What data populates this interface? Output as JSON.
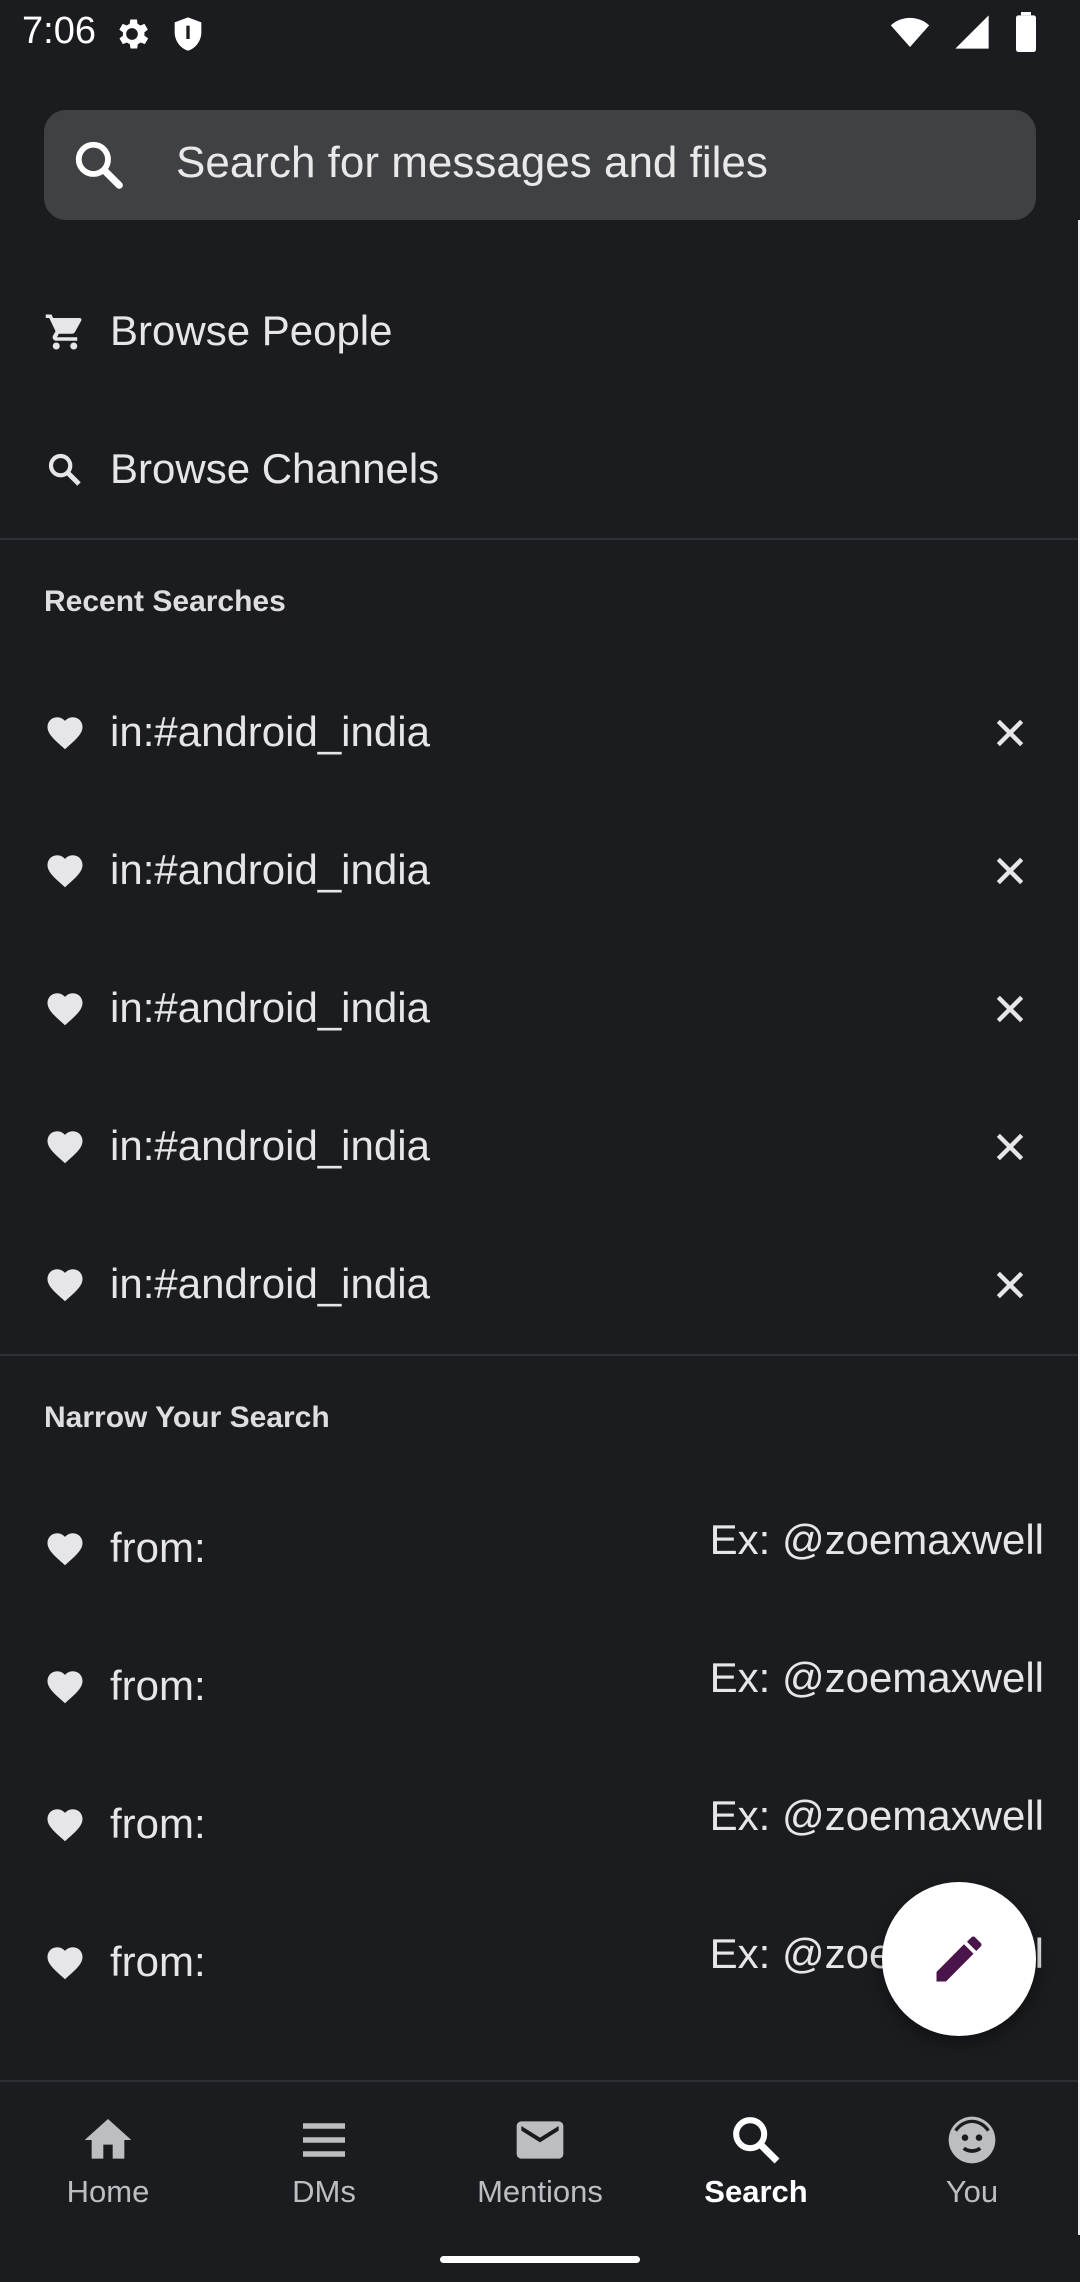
{
  "status": {
    "time": "7:06"
  },
  "search": {
    "placeholder": "Search for messages and files"
  },
  "browse": {
    "people_label": "Browse People",
    "channels_label": "Browse Channels"
  },
  "recent": {
    "title": "Recent Searches",
    "items": [
      {
        "label": "in:#android_india"
      },
      {
        "label": "in:#android_india"
      },
      {
        "label": "in:#android_india"
      },
      {
        "label": "in:#android_india"
      },
      {
        "label": "in:#android_india"
      }
    ]
  },
  "narrow": {
    "title": "Narrow Your Search",
    "items": [
      {
        "label": "from:",
        "hint": "Ex: @zoemaxwell"
      },
      {
        "label": "from:",
        "hint": "Ex: @zoemaxwell"
      },
      {
        "label": "from:",
        "hint": "Ex: @zoemaxwell"
      },
      {
        "label": "from:",
        "hint": "Ex: @zoemaxwell"
      }
    ]
  },
  "nav": {
    "home": "Home",
    "dms": "DMs",
    "mentions": "Mentions",
    "search": "Search",
    "you": "You"
  },
  "icons": {
    "fab": "pencil-icon",
    "browse_people": "cart-icon",
    "browse_channels": "search-icon",
    "recent_item": "heart-icon",
    "remove": "close-icon"
  },
  "colors": {
    "background": "#1b1c20",
    "search_field": "#404144",
    "fab": "#ffffff",
    "fab_icon": "#4a154b"
  }
}
